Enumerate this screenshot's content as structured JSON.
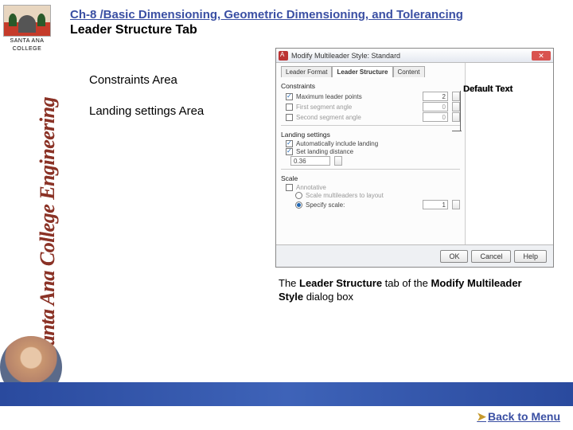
{
  "sidebar": {
    "logo_line1": "SANTA ANA",
    "logo_line2": "COLLEGE",
    "vertical_text": "Santa Ana College Engineering"
  },
  "header": {
    "chapter": "Ch-8 /Basic Dimensioning, Geometric Dimensioning, and Tolerancing",
    "subtitle": "Leader Structure Tab"
  },
  "bullets": {
    "item1": "Constraints Area",
    "item2": "Landing settings Area"
  },
  "dialog": {
    "title": "Modify Multileader Style: Standard",
    "close": "✕",
    "tabs": {
      "t1": "Leader Format",
      "t2": "Leader Structure",
      "t3": "Content"
    },
    "sections": {
      "constraints": "Constraints",
      "max_pts_label": "Maximum leader points",
      "max_pts_val": "2",
      "first_seg_label": "First segment angle",
      "first_seg_val": "0",
      "second_seg_label": "Second segment angle",
      "second_seg_val": "0",
      "landing": "Landing settings",
      "auto_landing": "Automatically include landing",
      "set_landing": "Set landing distance",
      "landing_val": "0.36",
      "scale": "Scale",
      "annotative": "Annotative",
      "scale_layout": "Scale multileaders to layout",
      "specify_scale": "Specify scale:",
      "scale_val": "1"
    },
    "buttons": {
      "ok": "OK",
      "cancel": "Cancel",
      "help": "Help"
    },
    "preview_label": "Default Text"
  },
  "caption": {
    "t1": "The ",
    "t2": "Leader Structure",
    "t3": " tab of the ",
    "t4": "Modify Multileader Style",
    "t5": " dialog box"
  },
  "footer": {
    "back": "Back to Menu"
  }
}
